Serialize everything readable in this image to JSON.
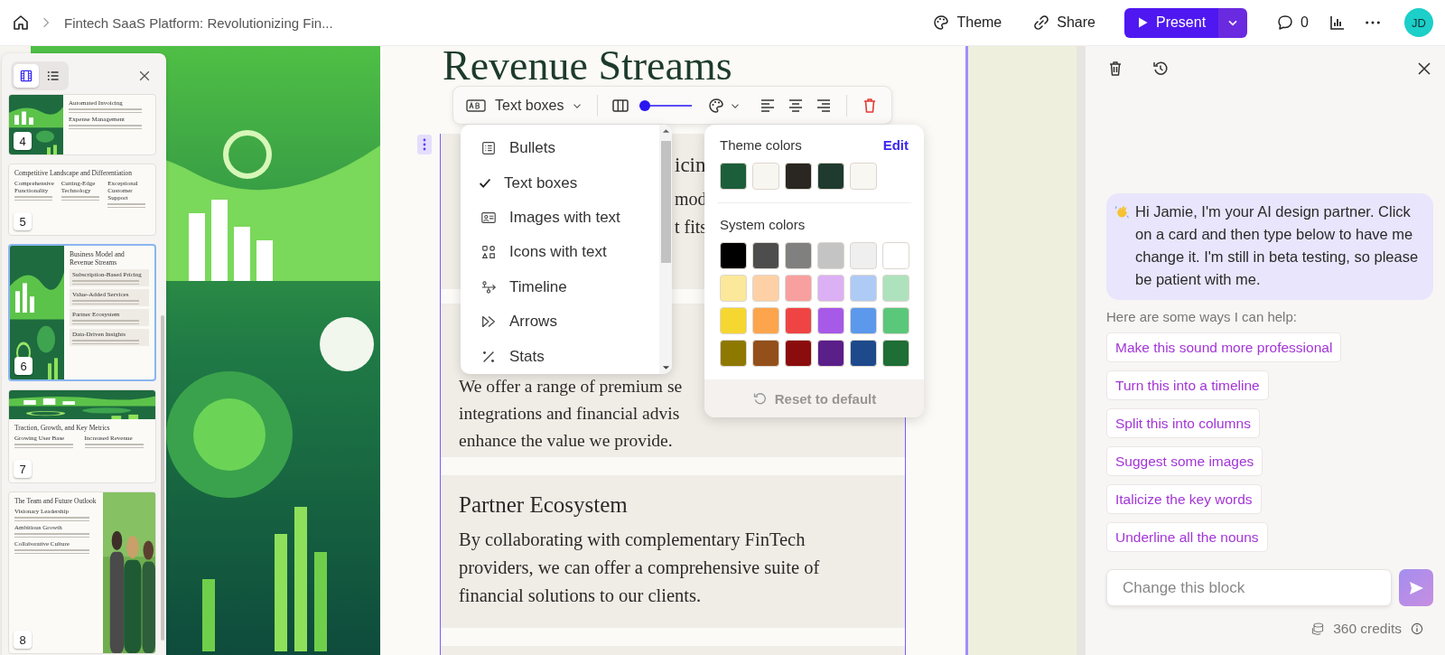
{
  "top_bar": {
    "breadcrumb": "Fintech SaaS Platform: Revolutionizing Fin...",
    "actions": [
      {
        "kind": "theme",
        "label": "Theme"
      },
      {
        "kind": "share",
        "label": "Share"
      }
    ],
    "present": "Present",
    "comment_count": "0",
    "avatar": "JD"
  },
  "slides_panel": {
    "views": [
      {
        "kind": "filmstrip",
        "selected": true
      },
      {
        "kind": "list",
        "selected": false
      }
    ],
    "slides": [
      {
        "number": "4",
        "kind": "image_left",
        "selected": false,
        "headings": [
          "Automated Invoicing",
          "Expense Management"
        ]
      },
      {
        "number": "5",
        "kind": "columns",
        "selected": false,
        "title": "Competitive Landscape and Differentiation",
        "headings": [
          "Comprehensive Functionality",
          "Cutting-Edge Technology",
          "Exceptional Customer Support"
        ]
      },
      {
        "number": "6",
        "kind": "image_left",
        "selected": true,
        "title": "Business Model and Revenue Streams",
        "headings": [
          "Subscription-Based Pricing",
          "Value-Added Services",
          "Partner Ecosystem",
          "Data-Driven Insights"
        ]
      },
      {
        "number": "7",
        "kind": "image_top",
        "selected": false,
        "title": "Traction, Growth, and Key Metrics",
        "headings": [
          "Growing User Base",
          "Increased Revenue"
        ]
      },
      {
        "number": "8",
        "kind": "image_right",
        "selected": false,
        "title": "The Team and Future Outlook",
        "headings": [
          "Visionary Leadership",
          "Ambitious Growth",
          "Collaborative Culture"
        ]
      }
    ]
  },
  "slide": {
    "title": "Revenue Streams",
    "cards": [
      {
        "kind": "covered",
        "lines": [
          "icin",
          "mod",
          "t fits"
        ]
      },
      {
        "kind": "heading_covered",
        "lines": [
          "We offer a range of premium se",
          "integrations and financial advis",
          "enhance the value we provide."
        ]
      },
      {
        "kind": "full",
        "heading": "Partner Ecosystem",
        "body": "By collaborating with complementary FinTech providers, we can offer a comprehensive suite of financial solutions to our clients."
      },
      {
        "kind": "empty"
      }
    ]
  },
  "toolbar": {
    "layout": "Text boxes",
    "width_slider": {
      "level": 0
    }
  },
  "layout_menu": {
    "items": [
      {
        "kind": "bullets",
        "label": "Bullets",
        "checked": false
      },
      {
        "label": "Text boxes",
        "checked": true
      },
      {
        "kind": "images",
        "label": "Images with text",
        "checked": false
      },
      {
        "kind": "icons",
        "label": "Icons with text",
        "checked": false
      },
      {
        "kind": "timeline",
        "label": "Timeline",
        "checked": false
      },
      {
        "kind": "arrows",
        "label": "Arrows",
        "checked": false
      },
      {
        "kind": "stats",
        "label": "Stats",
        "checked": false
      }
    ]
  },
  "color_popover": {
    "theme_title": "Theme colors",
    "edit": "Edit",
    "theme_colors": [
      {
        "color": "#1d5e3a"
      },
      {
        "color": "#f8f6f0"
      },
      {
        "color": "#2a2621"
      },
      {
        "color": "#1f3b2f"
      },
      {
        "color": "#f9f7f1"
      }
    ],
    "system_title": "System colors",
    "system_colors": [
      {
        "color": "#000000"
      },
      {
        "color": "#4d4d4d"
      },
      {
        "color": "#808080"
      },
      {
        "color": "#c4c4c4"
      },
      {
        "color": "#efefef"
      },
      {
        "color": "#ffffff"
      },
      {
        "color": "#fbe89a"
      },
      {
        "color": "#fdd1a5"
      },
      {
        "color": "#f8a0a0"
      },
      {
        "color": "#dcb0f4"
      },
      {
        "color": "#aecbf6"
      },
      {
        "color": "#aee2bd"
      },
      {
        "color": "#f6d631"
      },
      {
        "color": "#fca54c"
      },
      {
        "color": "#ef4444"
      },
      {
        "color": "#a75ae8"
      },
      {
        "color": "#5c98ec"
      },
      {
        "color": "#5bc77a"
      },
      {
        "color": "#8e7800"
      },
      {
        "color": "#93501a"
      },
      {
        "color": "#8b0c0c"
      },
      {
        "color": "#5b1f8a"
      },
      {
        "color": "#1e4a8c"
      },
      {
        "color": "#1e6e35"
      }
    ],
    "reset": "Reset to default"
  },
  "assistant": {
    "greeting": "Hi Jamie, I'm your AI design partner. Click on a card and then type below to have me change it. I'm still in beta testing, so please be patient with me.",
    "help_title": "Here are some ways I can help:",
    "suggestions": [
      "Make this sound more professional",
      "Turn this into a timeline",
      "Split this into columns",
      "Suggest some images",
      "Italicize the key words",
      "Underline all the nouns"
    ],
    "input": {
      "placeholder": "Change this block"
    },
    "credits": "360 credits"
  }
}
